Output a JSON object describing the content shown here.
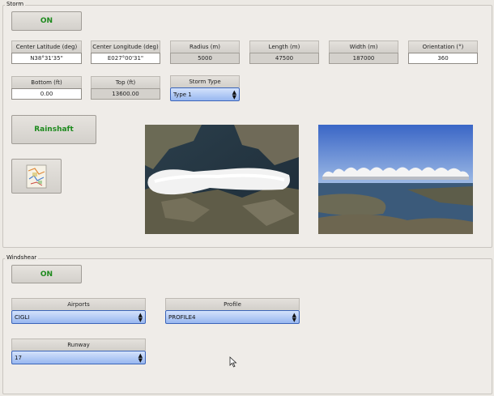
{
  "storm": {
    "title": "Storm",
    "on_label": "ON",
    "fields": [
      {
        "label": "Center Latitude (deg)",
        "value": "N38°31'35\"",
        "readonly": false
      },
      {
        "label": "Center Longitude (deg)",
        "value": "E027°00'31\"",
        "readonly": false
      },
      {
        "label": "Radius (m)",
        "value": "5000",
        "readonly": true
      },
      {
        "label": "Length (m)",
        "value": "47500",
        "readonly": true
      },
      {
        "label": "Width (m)",
        "value": "187000",
        "readonly": true
      },
      {
        "label": "Orientation (°)",
        "value": "360",
        "readonly": false
      },
      {
        "label": "Bottom (ft)",
        "value": "0.00",
        "readonly": false
      },
      {
        "label": "Top (ft)",
        "value": "13600.00",
        "readonly": true
      }
    ],
    "storm_type": {
      "label": "Storm Type",
      "value": "Type 1"
    },
    "rainshaft_label": "Rainshaft",
    "map_icon": "map-icon",
    "colors": {
      "on_text": "#1d8a1d",
      "combo": "#98b7f0"
    }
  },
  "windshear": {
    "title": "Windshear",
    "on_label": "ON",
    "airports": {
      "label": "Airports",
      "value": "CIGLI"
    },
    "profile": {
      "label": "Profile",
      "value": "PROFILE4"
    },
    "runway": {
      "label": "Runway",
      "value": "17"
    }
  }
}
